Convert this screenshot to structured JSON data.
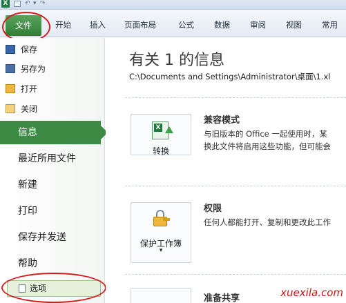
{
  "ribbon": {
    "tabs": [
      "文件",
      "开始",
      "插入",
      "页面布局",
      "公式",
      "数据",
      "审阅",
      "视图",
      "常用"
    ]
  },
  "backstage": {
    "commands": [
      {
        "label": "保存",
        "icon": "save-icon"
      },
      {
        "label": "另存为",
        "icon": "save-as-icon"
      },
      {
        "label": "打开",
        "icon": "open-folder-icon"
      },
      {
        "label": "关闭",
        "icon": "close-folder-icon"
      }
    ],
    "sections": [
      "信息",
      "最近所用文件",
      "新建",
      "打印",
      "保存并发送",
      "帮助"
    ],
    "selected_section": "信息",
    "options_label": "选项"
  },
  "info": {
    "title": "有关 1 的信息",
    "path": "C:\\Documents and Settings\\Administrator\\桌面\\1.xl",
    "compat": {
      "button_label": "转换",
      "heading": "兼容模式",
      "desc1": "与旧版本的 Office 一起使用时，某",
      "desc2": "换此文件将启用这些功能，但可能会"
    },
    "perm": {
      "button_label": "保护工作簿",
      "heading": "权限",
      "desc1": "任何人都能打开、复制和更改此工作"
    },
    "share": {
      "heading": "准备共享"
    }
  },
  "watermark": "xuexila.com",
  "colors": {
    "accent_green": "#3d8a45",
    "annotation_red": "#d81c1c"
  }
}
